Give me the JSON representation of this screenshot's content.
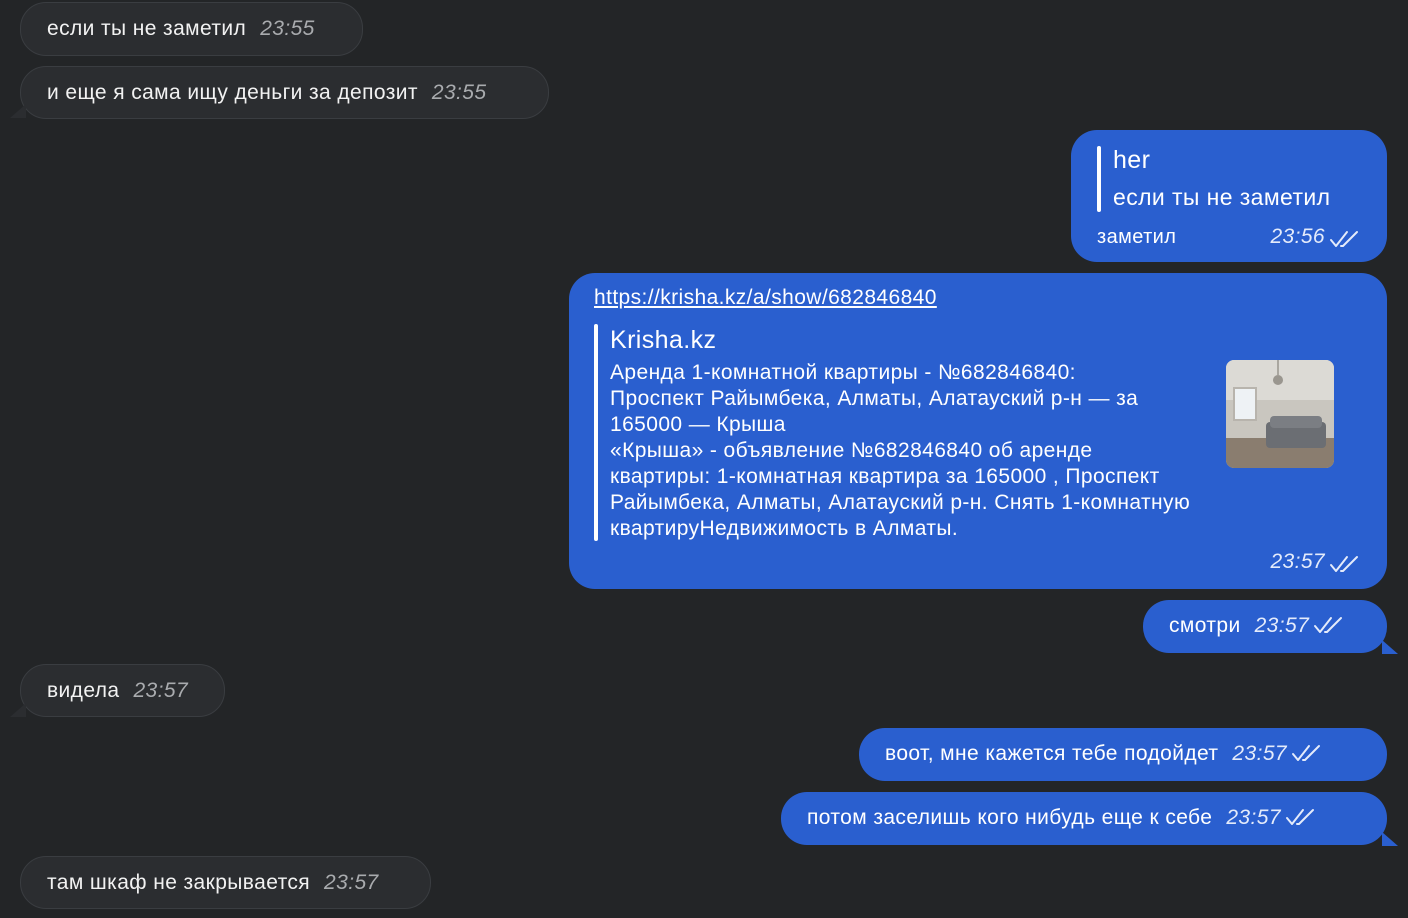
{
  "messages": {
    "m1": {
      "text": "если ты не заметил",
      "time": "23:55"
    },
    "m2": {
      "text": "и еще я сама ищу деньги за депозит",
      "time": "23:55"
    },
    "m3": {
      "reply_author": "her",
      "reply_text": "если ты не заметил",
      "text": "заметил",
      "time": "23:56"
    },
    "m4": {
      "url": "https://krisha.kz/a/show/682846840",
      "site": "Krisha.kz",
      "title_lines": [
        "Аренда 1-комнатной квартиры - №682846840:",
        "Проспект Райымбека, Алматы, Алатауский р-н — за",
        "165000 — Крыша"
      ],
      "desc_lines": [
        "«Крыша» - объявление №682846840 об аренде",
        "квартиры: 1-комнатная квартира за 165000 , Проспект",
        "Райымбека, Алматы, Алатауский р-н. Снять 1-комнатную",
        "квартируНедвижимость в Алматы."
      ],
      "time": "23:57"
    },
    "m5": {
      "text": "смотри",
      "time": "23:57"
    },
    "m6": {
      "text": "видела",
      "time": "23:57"
    },
    "m7": {
      "text": "воот, мне кажется тебе подойдет",
      "time": "23:57"
    },
    "m8": {
      "text": "потом заселишь кого нибудь еще к себе",
      "time": "23:57"
    },
    "m9": {
      "text": "там шкаф не закрывается",
      "time": "23:57"
    }
  },
  "colors": {
    "background": "#232527",
    "incoming_bubble": "#2b2d30",
    "outgoing_bubble": "#2a5fcf"
  },
  "icons": {
    "read_receipt": "double-check-icon"
  }
}
